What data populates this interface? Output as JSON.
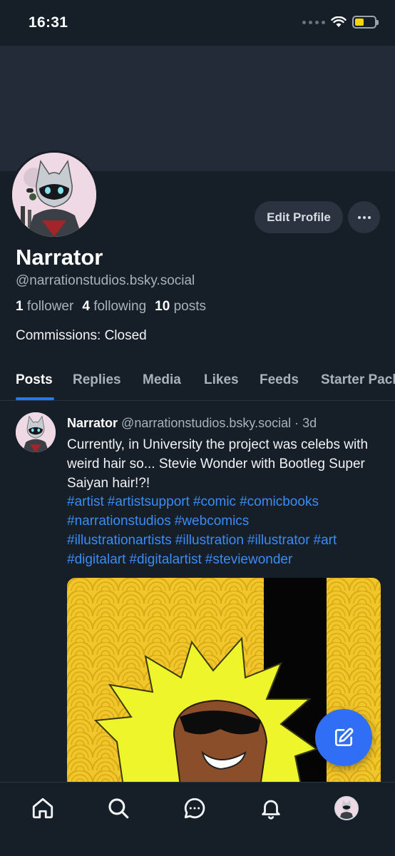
{
  "status_bar": {
    "time": "16:31",
    "battery_level": 0.45
  },
  "profile": {
    "display_name": "Narrator",
    "handle": "@narrationstudios.bsky.social",
    "followers_count": "1",
    "followers_label": "follower",
    "following_count": "4",
    "following_label": "following",
    "posts_count": "10",
    "posts_label": "posts",
    "bio": "Commissions: Closed",
    "edit_profile_label": "Edit Profile"
  },
  "tabs": [
    {
      "label": "Posts",
      "active": true
    },
    {
      "label": "Replies",
      "active": false
    },
    {
      "label": "Media",
      "active": false
    },
    {
      "label": "Likes",
      "active": false
    },
    {
      "label": "Feeds",
      "active": false
    },
    {
      "label": "Starter Packs",
      "active": false
    }
  ],
  "post": {
    "author_name": "Narrator",
    "author_handle": "@narrationstudios.bsky.social",
    "separator": "·",
    "time_ago": "3d",
    "text": "Currently, in University the project was celebs with weird hair so... Stevie Wonder with Bootleg Super Saiyan hair!?!",
    "hashtags": [
      "#artist",
      "#artistsupport",
      "#comic",
      "#comicbooks",
      "#narrationstudios",
      "#webcomics",
      "#illustrationartists",
      "#illustration",
      "#illustrator",
      "#art",
      "#digitalart",
      "#digitalartist",
      "#steviewonder"
    ]
  },
  "colors": {
    "background": "#161e27",
    "banner": "#232b38",
    "accent": "#1d7cf2",
    "hashtag": "#3b8cf5",
    "fab": "#2f6ef5"
  },
  "icons": {
    "nav": [
      "home-icon",
      "search-icon",
      "chat-icon",
      "bell-icon",
      "avatar"
    ],
    "fab": "compose-icon",
    "more": "ellipsis-icon"
  }
}
